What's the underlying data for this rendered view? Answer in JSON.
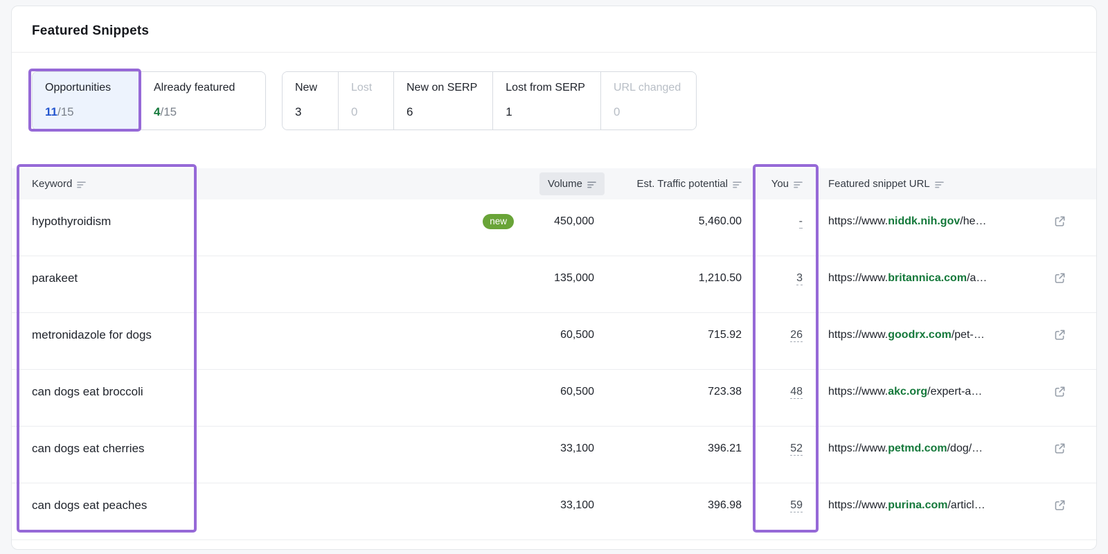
{
  "header": {
    "title": "Featured Snippets"
  },
  "tabs": [
    {
      "label": "Opportunities",
      "count": "11",
      "denom": "/15",
      "active": true
    },
    {
      "label": "Already featured",
      "count": "4",
      "denom": "/15",
      "active": false
    }
  ],
  "filters": [
    {
      "label": "New",
      "count": "3",
      "disabled": false
    },
    {
      "label": "Lost",
      "count": "0",
      "disabled": true
    },
    {
      "label": "New on SERP",
      "count": "6",
      "disabled": false
    },
    {
      "label": "Lost from SERP",
      "count": "1",
      "disabled": false
    },
    {
      "label": "URL changed",
      "count": "0",
      "disabled": true
    }
  ],
  "table": {
    "columns": [
      {
        "label": "Keyword",
        "sorted": false
      },
      {
        "label": "Volume",
        "sorted": true
      },
      {
        "label": "Est. Traffic potential",
        "sorted": false
      },
      {
        "label": "You",
        "sorted": false
      },
      {
        "label": "Featured snippet URL",
        "sorted": false
      }
    ],
    "rows": [
      {
        "keyword": "hypothyroidism",
        "badge": "new",
        "volume": "450,000",
        "traffic": "5,460.00",
        "you": "-",
        "url_prefix": "https://www.",
        "url_domain": "niddk.nih.gov",
        "url_path": "/he…"
      },
      {
        "keyword": "parakeet",
        "volume": "135,000",
        "traffic": "1,210.50",
        "you": "3",
        "url_prefix": "https://www.",
        "url_domain": "britannica.com",
        "url_path": "/a…"
      },
      {
        "keyword": "metronidazole for dogs",
        "volume": "60,500",
        "traffic": "715.92",
        "you": "26",
        "url_prefix": "https://www.",
        "url_domain": "goodrx.com",
        "url_path": "/pet-…"
      },
      {
        "keyword": "can dogs eat broccoli",
        "volume": "60,500",
        "traffic": "723.38",
        "you": "48",
        "url_prefix": "https://www.",
        "url_domain": "akc.org",
        "url_path": "/expert-a…"
      },
      {
        "keyword": "can dogs eat cherries",
        "volume": "33,100",
        "traffic": "396.21",
        "you": "52",
        "url_prefix": "https://www.",
        "url_domain": "petmd.com",
        "url_path": "/dog/…"
      },
      {
        "keyword": "can dogs eat peaches",
        "volume": "33,100",
        "traffic": "396.98",
        "you": "59",
        "url_prefix": "https://www.",
        "url_domain": "purina.com",
        "url_path": "/articl…"
      }
    ]
  },
  "icons": {
    "sort": "≡",
    "external_link": "↗"
  },
  "colors": {
    "annotation_purple": "#9669d7",
    "accent_blue": "#2456cf",
    "link_green": "#15793b",
    "badge_green": "#69a438",
    "disabled_gray": "#b8bec6",
    "active_tab_bg": "#edf3fd"
  },
  "annotations": [
    {
      "target": "opportunities-tab"
    },
    {
      "target": "keyword-column"
    },
    {
      "target": "you-column"
    }
  ]
}
